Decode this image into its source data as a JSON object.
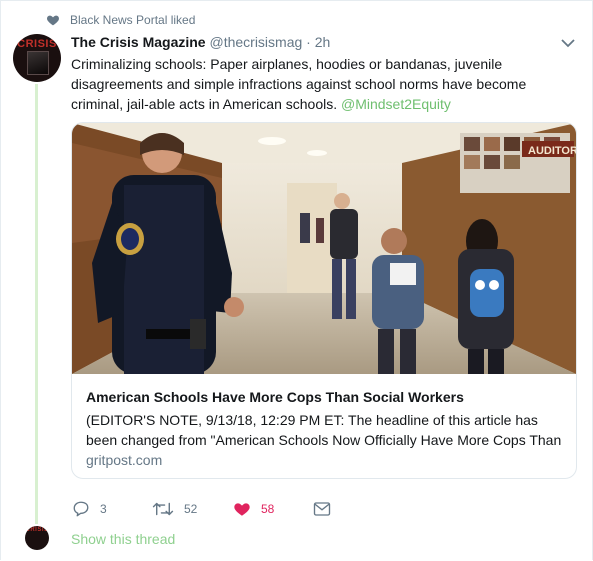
{
  "liked_notice": {
    "text": "Black News Portal liked"
  },
  "tweet": {
    "avatar_text": "CRISIS",
    "author_name": "The Crisis Magazine",
    "author_handle": "@thecrisismag",
    "separator": "·",
    "time": "2h",
    "text": "Criminalizing schools: Paper airplanes, hoodies or bandanas, juvenile disagreements and simple infractions against school norms have become criminal, jail-able acts in American schools.",
    "mention": "@Mindset2Equity"
  },
  "card": {
    "photo_sign_text": "AUDITOR",
    "title": "American Schools Have More Cops Than Social Workers",
    "description": "(EDITOR'S NOTE, 9/13/18, 12:29 PM ET: The headline of this article has been changed from \"American Schools Now Officially Have More Cops Than",
    "domain": "gritpost.com"
  },
  "actions": {
    "reply_count": "3",
    "retweet_count": "52",
    "like_count": "58"
  },
  "thread": {
    "show_label": "Show this thread"
  },
  "colors": {
    "like": "#e0245e",
    "link": "#6fbf6f",
    "muted": "#657786",
    "thread_line": "#d8f0d0"
  },
  "icons": [
    "heart-icon",
    "chevron-down-icon",
    "reply-icon",
    "retweet-icon",
    "like-heart-icon",
    "message-icon"
  ]
}
